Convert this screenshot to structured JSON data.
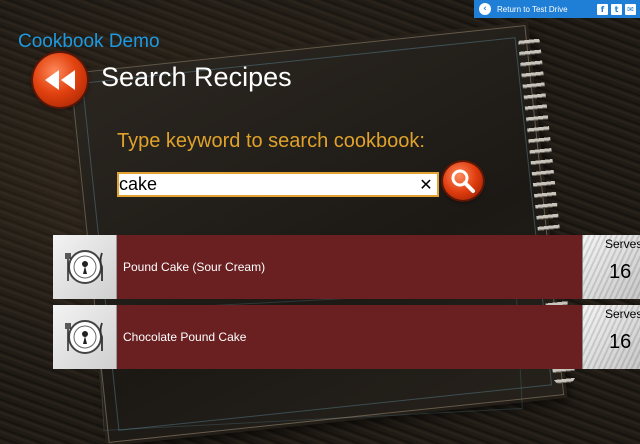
{
  "topbar": {
    "return_label": "Return to Test Drive",
    "social": [
      "f",
      "t",
      "✉"
    ]
  },
  "app": {
    "title": "Cookbook Demo"
  },
  "page": {
    "title": "Search Recipes"
  },
  "search": {
    "prompt": "Type keyword to search cookbook:",
    "value": "cake",
    "clear_glyph": "✕"
  },
  "results": [
    {
      "name": "Pound Cake (Sour Cream)",
      "serves_label": "Serves",
      "serves": "16"
    },
    {
      "name": "Chocolate Pound Cake",
      "serves_label": "Serves",
      "serves": "16"
    }
  ],
  "colors": {
    "accent_blue": "#1d9ae0",
    "prompt_orange": "#e0a22a",
    "row_bg": "#6a1f21",
    "button_red": "#e2420f"
  }
}
